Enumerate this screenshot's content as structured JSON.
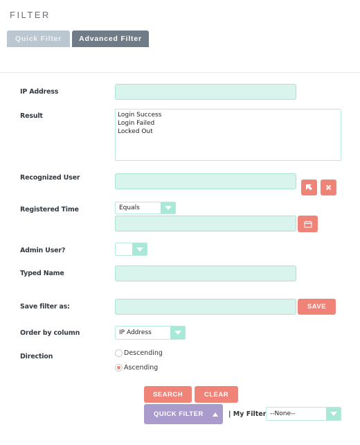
{
  "header": {
    "title": "FILTER"
  },
  "tabs": [
    {
      "label": "Quick Filter",
      "active": false
    },
    {
      "label": "Advanced Filter",
      "active": true
    }
  ],
  "fields": {
    "ip_address": {
      "label": "IP Address",
      "value": ""
    },
    "result": {
      "label": "Result",
      "options": [
        "Login Success",
        "Login Failed",
        "Locked Out"
      ]
    },
    "recognized_user": {
      "label": "Recognized User",
      "value": ""
    },
    "registered_time": {
      "label": "Registered Time",
      "operator": "Equals",
      "value": ""
    },
    "admin_user": {
      "label": "Admin User?",
      "value": ""
    },
    "typed_name": {
      "label": "Typed Name",
      "value": ""
    },
    "save_filter": {
      "label": "Save filter as:",
      "value": "",
      "button": "SAVE"
    },
    "order_by": {
      "label": "Order by column",
      "value": "IP Address"
    },
    "direction": {
      "label": "Direction",
      "options": [
        {
          "label": "Descending",
          "selected": false
        },
        {
          "label": "Ascending",
          "selected": true
        }
      ]
    }
  },
  "actions": {
    "search": "SEARCH",
    "clear": "CLEAR",
    "quick_filter": "QUICK FILTER",
    "my_filters_label": "| My Filters",
    "my_filters_value": "--None--"
  },
  "icons": {
    "select_user": "cursor-arrow-icon",
    "clear_user": "close-icon",
    "calendar": "calendar-icon",
    "dropdown": "chevron-down-icon",
    "collapse": "triangle-up-icon"
  },
  "colors": {
    "accent_red": "#f08377",
    "input_bg": "#d8f4ec",
    "input_border": "#a7e5d1",
    "purple": "#a99bcb",
    "tab_active": "#6f7b86",
    "tab_inactive": "#bac7d1"
  }
}
